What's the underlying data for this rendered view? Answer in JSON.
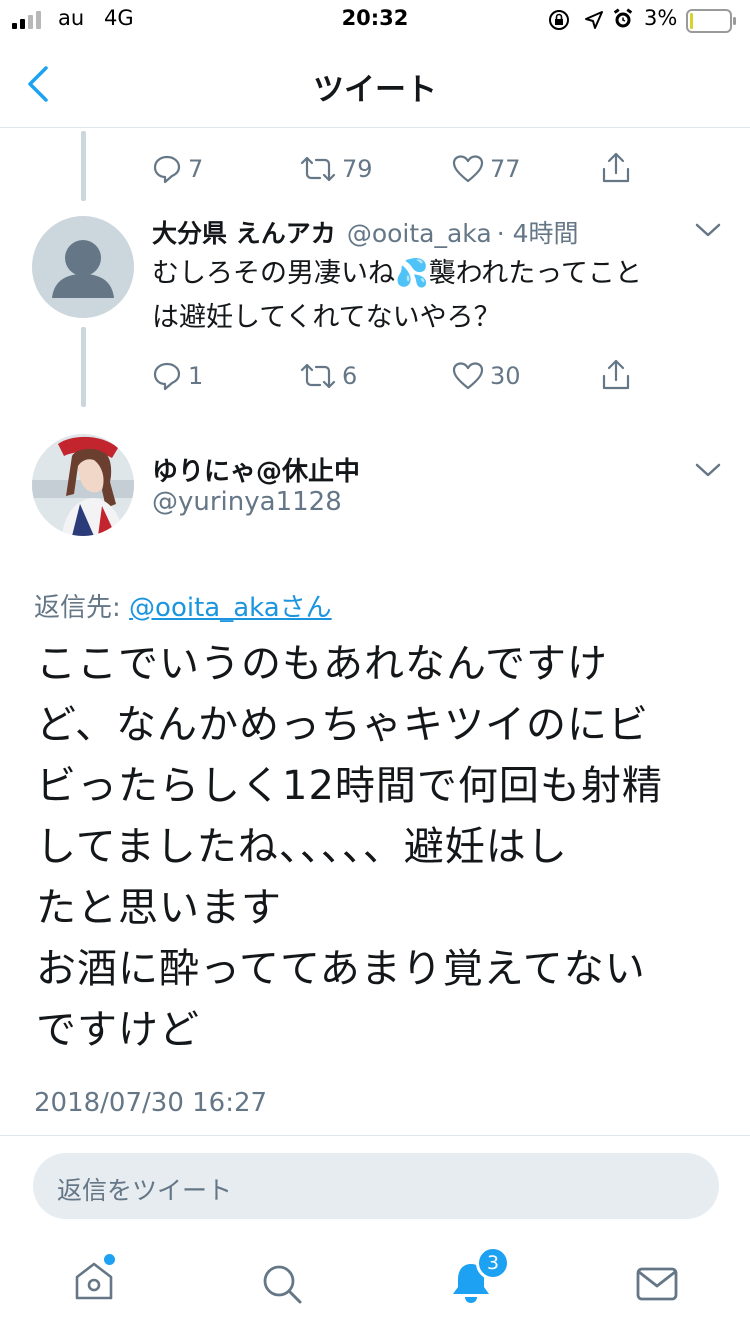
{
  "status_bar": {
    "carrier": "au",
    "network": "4G",
    "time": "20:32",
    "battery": "3%"
  },
  "nav": {
    "title": "ツイート"
  },
  "prev_tweet_actions": {
    "replies": "7",
    "retweets": "79",
    "likes": "77"
  },
  "reply_tweet": {
    "name": "大分県 えんアカ",
    "handle": "@ooita_aka",
    "time": "· 4時間",
    "text_line1": "むしろその男凄いね💦襲われたってこと",
    "text_line2": "は避妊してくれてないやろ？",
    "replies": "1",
    "retweets": "6",
    "likes": "30"
  },
  "main_tweet": {
    "name": "ゆりにゃ@休止中",
    "handle": "@yurinya1128",
    "reply_to_prefix": "返信先: ",
    "reply_to_user": "@ooita_akaさん",
    "lines": [
      "ここでいうのもあれなんですけ",
      "ど、なんかめっちゃキツイのにビ",
      "ビったらしく12時間で何回も射精",
      "してましたね、、、、、避妊はし",
      "たと思います",
      "お酒に酔っててあまり覚えてない",
      "ですけど"
    ],
    "timestamp": "2018/07/30 16:27"
  },
  "reply_input": {
    "placeholder": "返信をツイート"
  },
  "tabbar": {
    "notifications_badge": "3"
  },
  "colors": {
    "accent": "#1da1f2",
    "text": "#14171a",
    "secondary": "#657786",
    "line": "#ccd6dd"
  }
}
